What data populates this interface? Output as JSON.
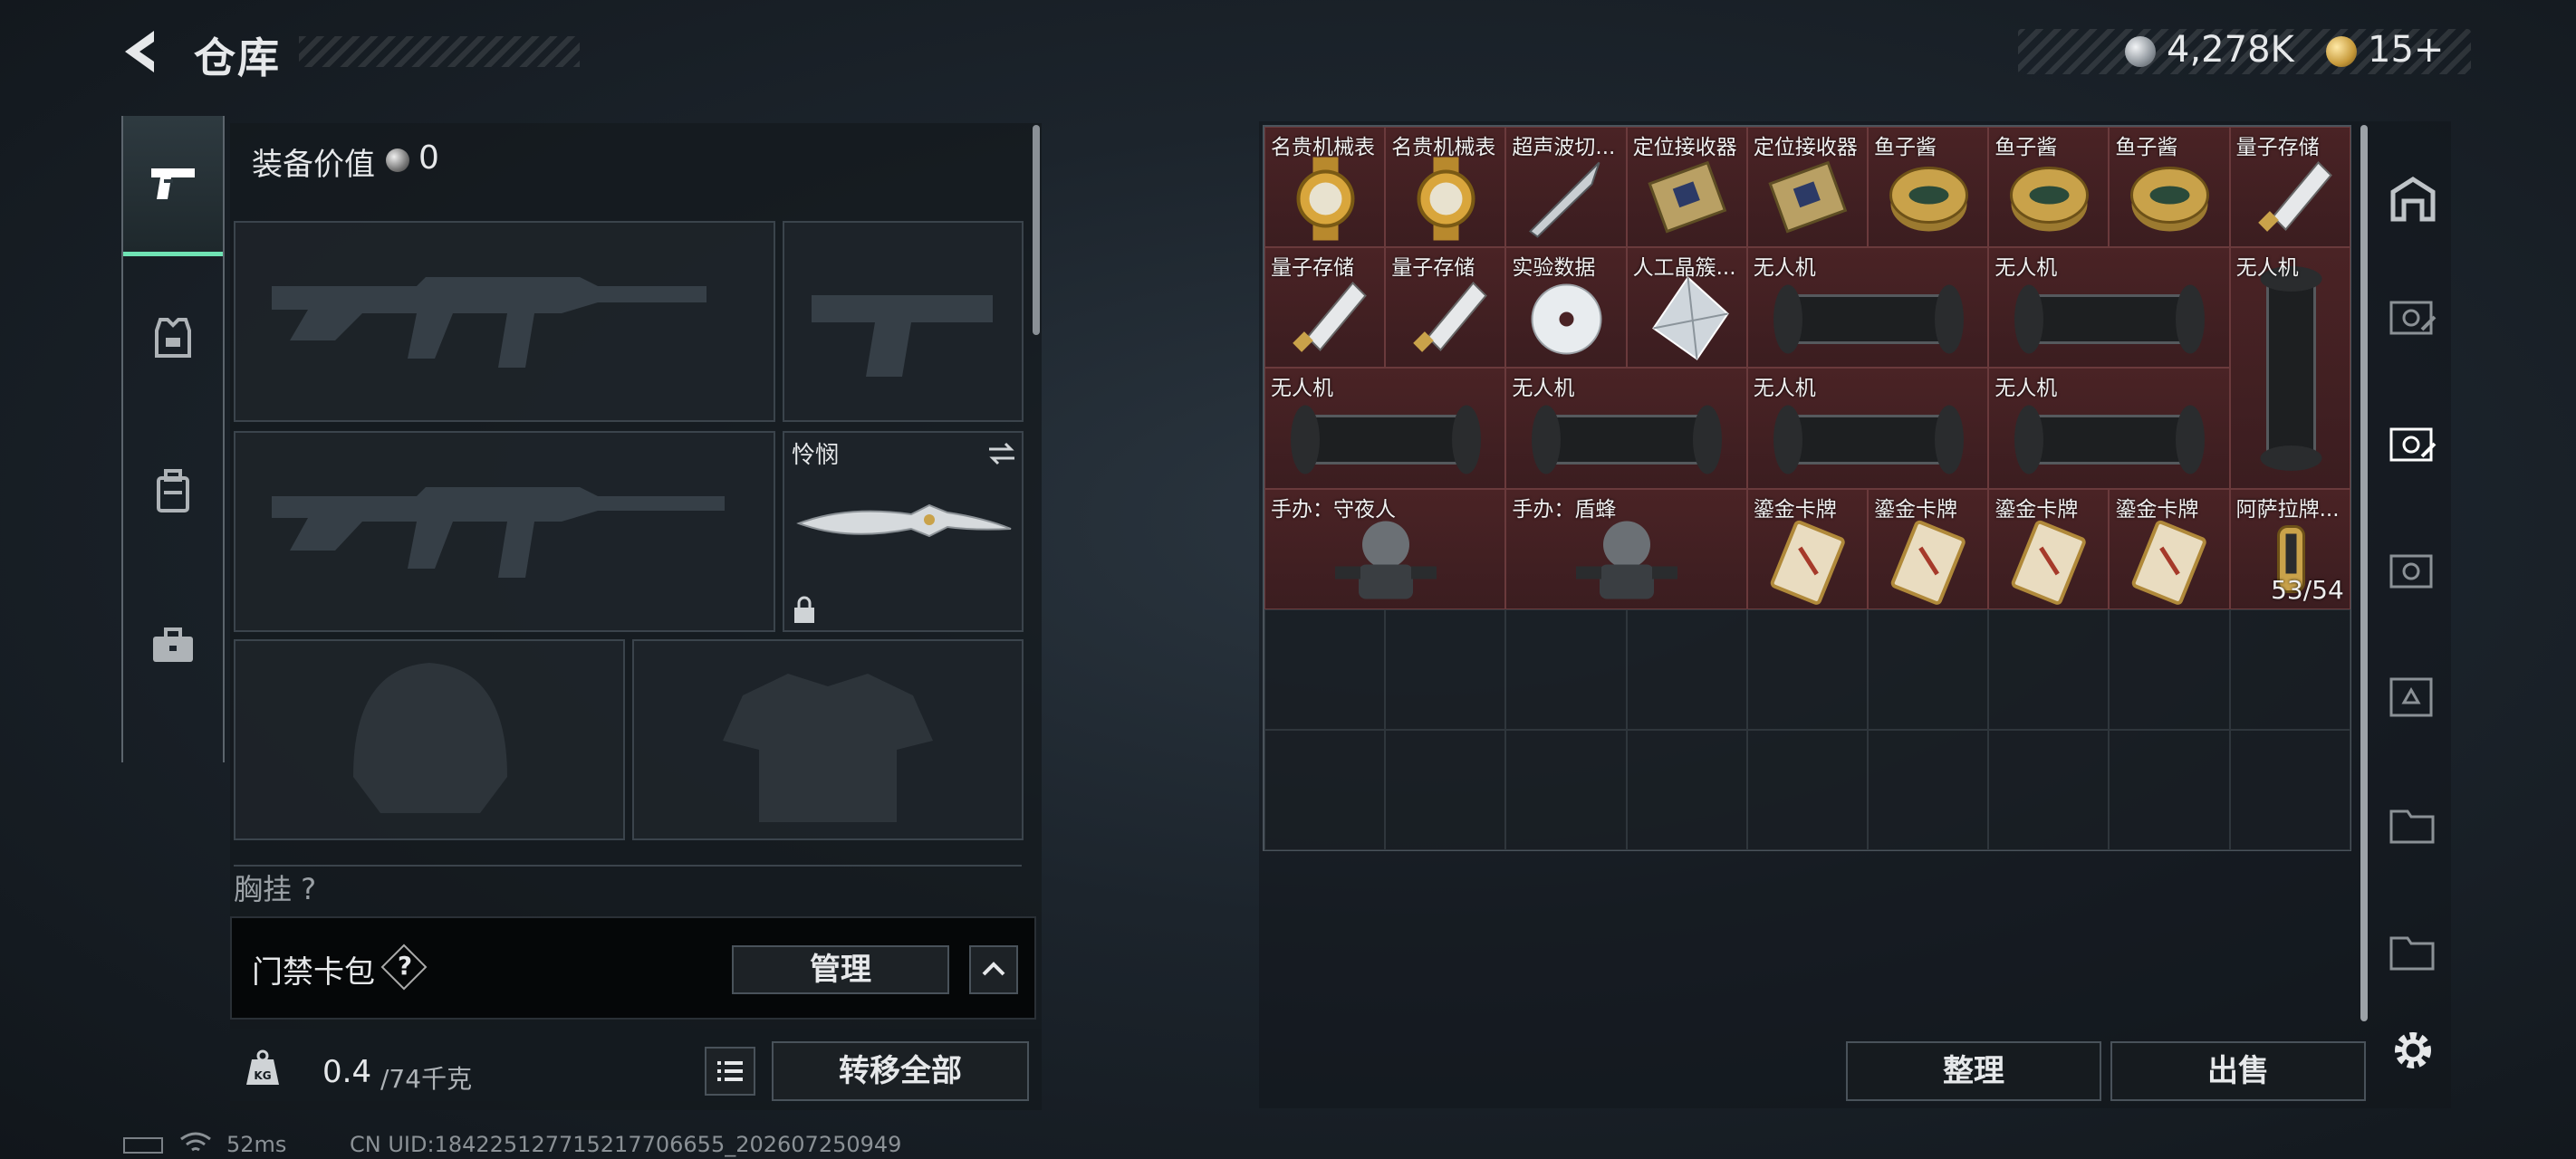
{
  "header": {
    "title": "仓库"
  },
  "currency": {
    "silver": "4,278K",
    "gold": "15+"
  },
  "equipment": {
    "value_label": "装备价值",
    "value": "0",
    "melee_name": "怜悯",
    "chest_label": "胸挂 ?"
  },
  "access": {
    "label": "门禁卡包",
    "help": "?",
    "manage_label": "管理"
  },
  "weight": {
    "current": "0.4",
    "max_unit": "/74千克",
    "kg_label": "KG"
  },
  "buttons": {
    "transfer_all": "转移全部",
    "sort": "整理",
    "sell": "出售"
  },
  "storage_items": [
    {
      "name": "名贵机械表",
      "icon": "watch-icon"
    },
    {
      "name": "名贵机械表",
      "icon": "watch-icon"
    },
    {
      "name": "超声波切...",
      "icon": "scalpel-icon"
    },
    {
      "name": "定位接收器",
      "icon": "receiver-icon"
    },
    {
      "name": "定位接收器",
      "icon": "receiver-icon"
    },
    {
      "name": "鱼子酱",
      "icon": "caviar-icon"
    },
    {
      "name": "鱼子酱",
      "icon": "caviar-icon"
    },
    {
      "name": "鱼子酱",
      "icon": "caviar-icon"
    },
    {
      "name": "量子存储",
      "icon": "usb-icon"
    },
    {
      "name": "量子存储",
      "icon": "usb-icon"
    },
    {
      "name": "量子存储",
      "icon": "usb-icon"
    },
    {
      "name": "实验数据",
      "icon": "disc-icon"
    },
    {
      "name": "人工晶簇...",
      "icon": "crystal-icon"
    },
    {
      "name": "无人机",
      "icon": "drone-icon"
    },
    {
      "name": "无人机",
      "icon": "drone-icon"
    },
    {
      "name": "无人机",
      "icon": "drone-icon"
    },
    {
      "name": "无人机",
      "icon": "drone-icon"
    },
    {
      "name": "无人机",
      "icon": "drone-icon"
    },
    {
      "name": "无人机",
      "icon": "drone-icon"
    },
    {
      "name": "无人机",
      "icon": "drone-icon"
    },
    {
      "name": "手办：守夜人",
      "icon": "figure-icon"
    },
    {
      "name": "手办：盾蜂",
      "icon": "figure-icon"
    },
    {
      "name": "鎏金卡牌",
      "icon": "card-icon"
    },
    {
      "name": "鎏金卡牌",
      "icon": "card-icon"
    },
    {
      "name": "鎏金卡牌",
      "icon": "card-icon"
    },
    {
      "name": "鎏金卡牌",
      "icon": "card-icon"
    },
    {
      "name": "阿萨拉牌...",
      "icon": "ammo-icon",
      "count": "53/54"
    }
  ],
  "status": {
    "ping": "52ms",
    "uid": "CN UID:18422512771521770​6655_202607250949"
  },
  "colors": {
    "accent": "#6fe3b4",
    "item_bg": "#4a2325",
    "border": "#49525a"
  }
}
